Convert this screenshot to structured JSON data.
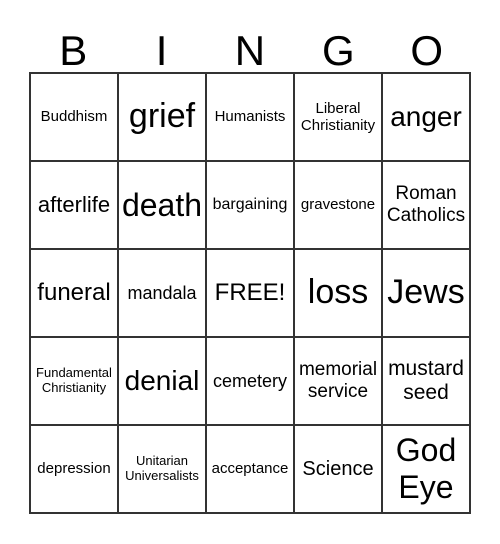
{
  "header": [
    "B",
    "I",
    "N",
    "G",
    "O"
  ],
  "cells": [
    "Buddhism",
    "grief",
    "Humanists",
    "Liberal Christianity",
    "anger",
    "afterlife",
    "death",
    "bargaining",
    "gravestone",
    "Roman Catholics",
    "funeral",
    "mandala",
    "FREE!",
    "loss",
    "Jews",
    "Fundamental Christianity",
    "denial",
    "cemetery",
    "memorial service",
    "mustard seed",
    "depression",
    "Unitarian Universalists",
    "acceptance",
    "Science",
    "God Eye"
  ]
}
